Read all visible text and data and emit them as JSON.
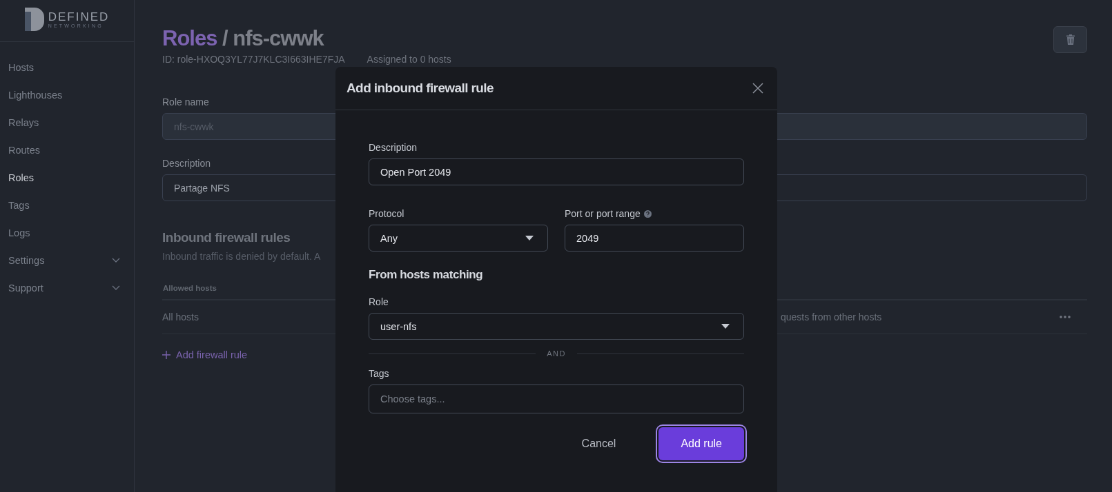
{
  "logo": {
    "name": "DEFINED",
    "subtitle": "NETWORKING"
  },
  "sidebar": {
    "items": [
      {
        "label": "Hosts",
        "selected": false,
        "expandable": false
      },
      {
        "label": "Lighthouses",
        "selected": false,
        "expandable": false
      },
      {
        "label": "Relays",
        "selected": false,
        "expandable": false
      },
      {
        "label": "Routes",
        "selected": false,
        "expandable": false
      },
      {
        "label": "Roles",
        "selected": true,
        "expandable": false
      },
      {
        "label": "Tags",
        "selected": false,
        "expandable": false
      },
      {
        "label": "Logs",
        "selected": false,
        "expandable": false
      },
      {
        "label": "Settings",
        "selected": false,
        "expandable": true
      },
      {
        "label": "Support",
        "selected": false,
        "expandable": true
      }
    ]
  },
  "page": {
    "breadcrumb": "Roles",
    "separator": "/",
    "title": "nfs-cwwk",
    "id_text": "ID: role-HXOQ3YL77J7KLC3I663IHE7FJA",
    "assigned_text": "Assigned to 0 hosts",
    "role_name_label": "Role name",
    "role_name_value": "nfs-cwwk",
    "description_label": "Description",
    "description_value": "Partage NFS",
    "rules_heading": "Inbound firewall rules",
    "rules_subtitle": "Inbound traffic is denied by default. A",
    "table": {
      "columns": [
        "Allowed hosts"
      ],
      "rows": [
        {
          "cells": [
            "All hosts",
            "quests from other hosts"
          ]
        }
      ]
    },
    "add_rule_link": "Add firewall rule"
  },
  "modal": {
    "title": "Add inbound firewall rule",
    "description_label": "Description",
    "description_value": "Open Port 2049",
    "protocol_label": "Protocol",
    "protocol_value": "Any",
    "port_label": "Port or port range",
    "port_value": "2049",
    "section_heading": "From hosts matching",
    "role_label": "Role",
    "role_value": "user-nfs",
    "divider_text": "AND",
    "tags_label": "Tags",
    "tags_placeholder": "Choose tags...",
    "buttons": [
      {
        "label": "Cancel",
        "kind": "secondary"
      },
      {
        "label": "Add rule",
        "kind": "primary"
      }
    ]
  }
}
